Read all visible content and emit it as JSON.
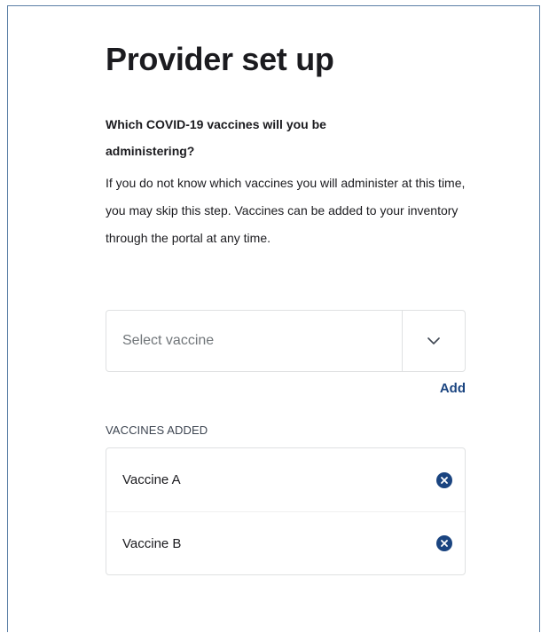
{
  "page": {
    "title": "Provider set up",
    "question": "Which COVID-19 vaccines will you be administering?",
    "helper_text": "If you do not know which vaccines you will administer at this time, you may skip this step. Vaccines can be added to your inventory through the portal at any time."
  },
  "vaccine_select": {
    "placeholder": "Select vaccine",
    "toggle_icon": "chevron-down-icon"
  },
  "add_link_label": "Add",
  "vaccines_added": {
    "label": "VACCINES ADDED",
    "items": [
      {
        "name": "Vaccine A",
        "remove_icon": "close-circle-icon"
      },
      {
        "name": "Vaccine B",
        "remove_icon": "close-circle-icon"
      }
    ]
  },
  "colors": {
    "accent": "#1a4480",
    "border": "#dfe1e2",
    "frame": "#5b7fa6",
    "placeholder": "#71767a"
  }
}
